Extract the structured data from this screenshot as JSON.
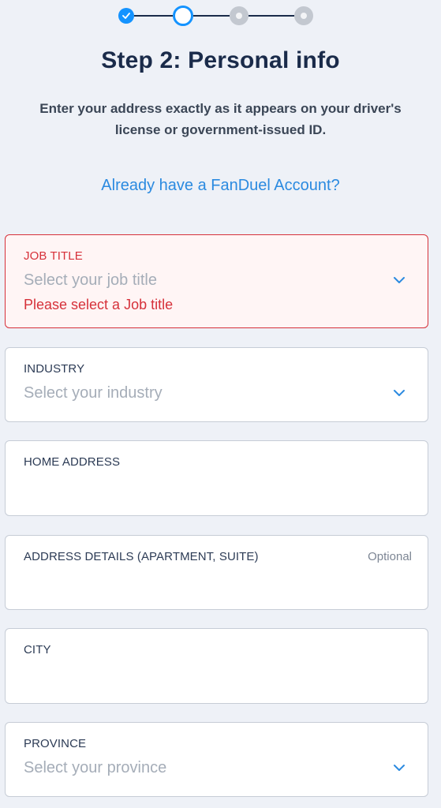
{
  "stepper": {
    "steps": [
      {
        "state": "complete",
        "icon": "check-icon"
      },
      {
        "state": "current",
        "icon": "ring-icon"
      },
      {
        "state": "upcoming",
        "icon": "dot-icon"
      },
      {
        "state": "upcoming",
        "icon": "dot-icon"
      }
    ],
    "accent_color": "#1493ff"
  },
  "header": {
    "title": "Step 2: Personal info",
    "subtitle_line1": "Enter your address exactly as it appears on your driver's",
    "subtitle_line2": "license or government-issued ID."
  },
  "account_link": "Already have a FanDuel Account?",
  "fields": {
    "job_title": {
      "label": "JOB TITLE",
      "placeholder": "Select your job title",
      "error": "Please select a Job title"
    },
    "industry": {
      "label": "INDUSTRY",
      "placeholder": "Select your industry"
    },
    "home_address": {
      "label": "HOME ADDRESS",
      "value": ""
    },
    "address_details": {
      "label": "ADDRESS DETAILS (APARTMENT, SUITE)",
      "optional": "Optional",
      "value": ""
    },
    "city": {
      "label": "CITY",
      "value": ""
    },
    "province": {
      "label": "PROVINCE",
      "placeholder": "Select your province"
    }
  },
  "colors": {
    "error": "#d6313a",
    "link": "#2b8ae0",
    "heading": "#1a2b4a"
  }
}
